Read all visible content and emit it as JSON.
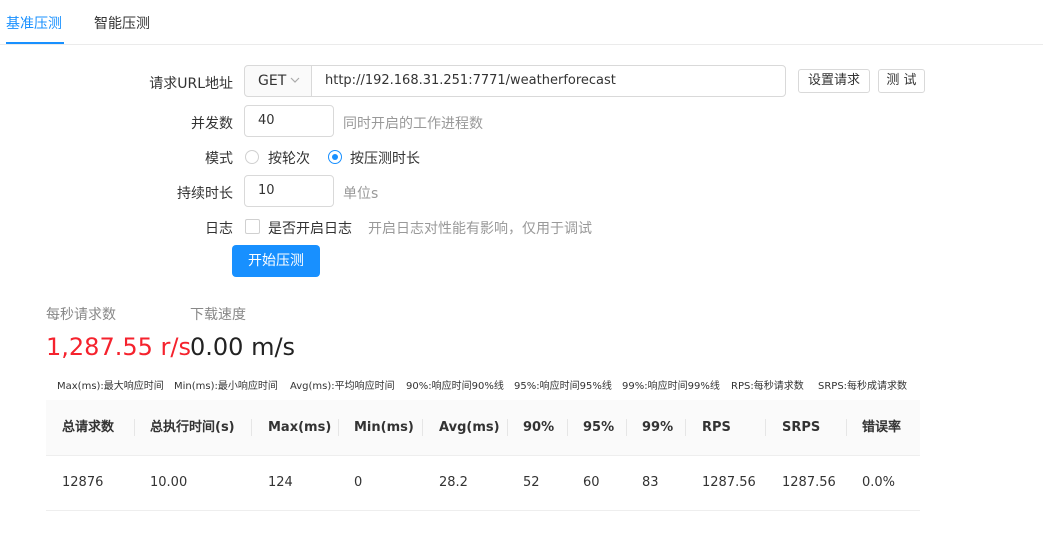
{
  "tabs": [
    {
      "label": "基准压测",
      "active": true
    },
    {
      "label": "智能压测",
      "active": false
    }
  ],
  "form": {
    "url_label": "请求URL地址",
    "method": "GET",
    "url": "http://192.168.31.251:7771/weatherforecast",
    "settings_button": "设置请求",
    "test_button": "测 试",
    "concurrency_label": "并发数",
    "concurrency_value": "40",
    "concurrency_hint": "同时开启的工作进程数",
    "mode_label": "模式",
    "mode_options": [
      {
        "label": "按轮次",
        "checked": false
      },
      {
        "label": "按压测时长",
        "checked": true
      }
    ],
    "duration_label": "持续时长",
    "duration_value": "10",
    "duration_hint": "单位s",
    "log_label": "日志",
    "log_checkbox_label": "是否开启日志",
    "log_checked": false,
    "log_hint": "开启日志对性能有影响，仅用于调试",
    "start_button": "开始压测"
  },
  "stats": {
    "rps_label": "每秒请求数",
    "rps_value": "1,287.55 r/s",
    "rps_color": "#f5222d",
    "download_label": "下载速度",
    "download_value": "0.00 m/s",
    "download_color": "#222222"
  },
  "legend": [
    "Max(ms):最大响应时间",
    "Min(ms):最小响应时间",
    "Avg(ms):平均响应时间",
    "90%:响应时间90%线",
    "95%:响应时间95%线",
    "99%:响应时间99%线",
    "RPS:每秒请求数",
    "SRPS:每秒成请求数"
  ],
  "table": {
    "headers": [
      "总请求数",
      "总执行时间(s)",
      "Max(ms)",
      "Min(ms)",
      "Avg(ms)",
      "90%",
      "95%",
      "99%",
      "RPS",
      "SRPS",
      "错误率"
    ],
    "rows": [
      [
        "12876",
        "10.00",
        "124",
        "0",
        "28.2",
        "52",
        "60",
        "83",
        "1287.56",
        "1287.56",
        "0.0%"
      ]
    ]
  },
  "colors": {
    "accent": "#1890ff"
  }
}
